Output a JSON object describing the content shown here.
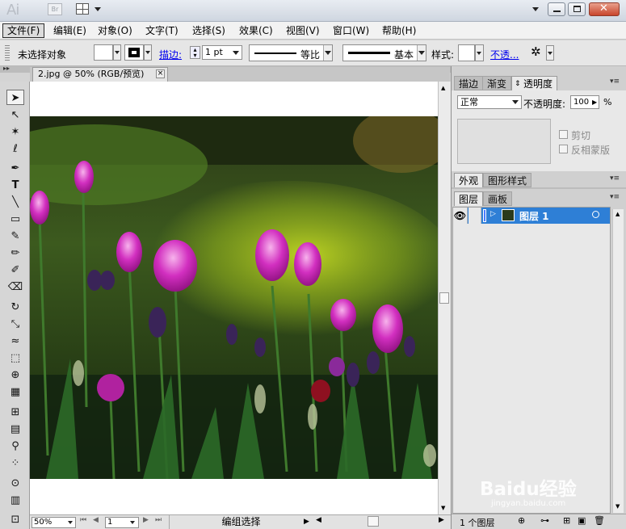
{
  "app": {
    "logo": "Ai",
    "bridge": "Br"
  },
  "menu": [
    "文件(F)",
    "编辑(E)",
    "对象(O)",
    "文字(T)",
    "选择(S)",
    "效果(C)",
    "视图(V)",
    "窗口(W)",
    "帮助(H)"
  ],
  "control": {
    "no_selection": "未选择对象",
    "stroke_label": "描边:",
    "stroke_weight": "1 pt",
    "profile_uniform": "等比",
    "brush_basic": "基本",
    "style_label": "样式:",
    "opacity_link": "不透..."
  },
  "document": {
    "tab": "2.jpg @ 50% (RGB/预览)",
    "close": "×"
  },
  "status": {
    "zoom": "50%",
    "artboard": "1",
    "tool_state": "编组选择"
  },
  "panels": {
    "top_tabs": [
      "描边",
      "渐变",
      "透明度"
    ],
    "blend_mode": "正常",
    "opacity_label": "不透明度:",
    "opacity_value": "100",
    "percent": "%",
    "clip": "剪切",
    "invert_mask": "反相蒙版",
    "mid_tabs": [
      "外观",
      "图形样式"
    ],
    "layer_tabs": [
      "图层",
      "画板"
    ],
    "layer_name": "图层 1",
    "layer_count": "1 个图层"
  },
  "watermark": {
    "brand": "Baidu经验",
    "url": "jingyan.baidu.com"
  },
  "colors": {
    "selection": "#2e7fd6",
    "link": "#0000ee"
  }
}
